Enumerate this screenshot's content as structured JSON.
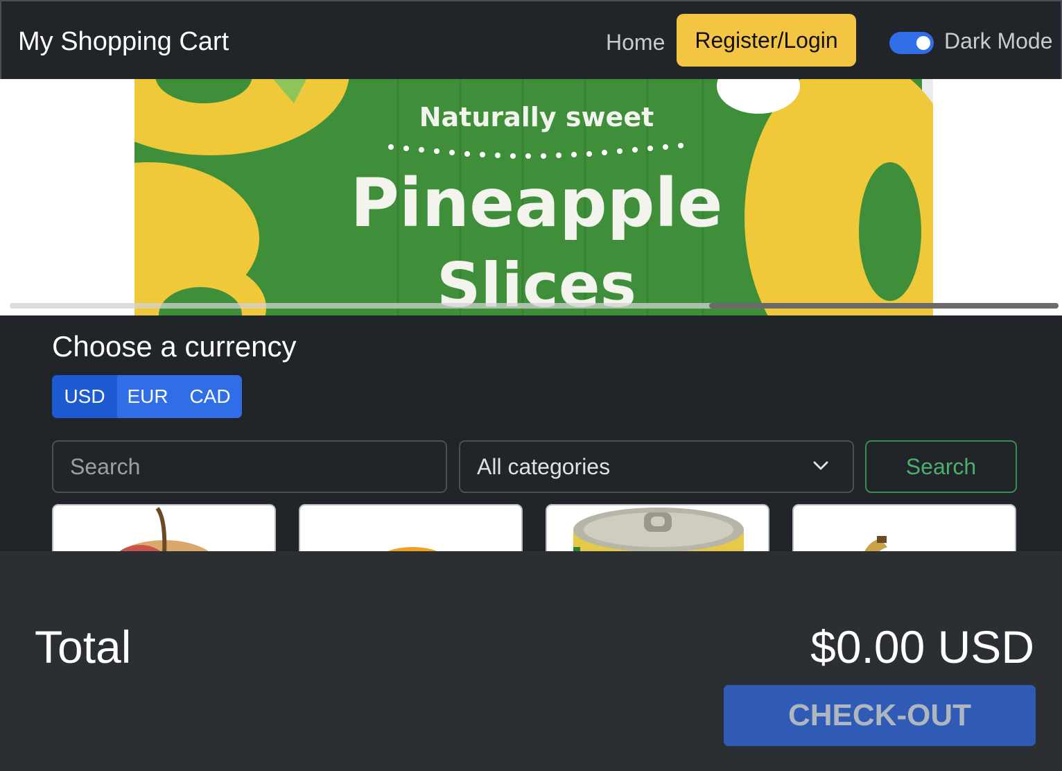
{
  "navbar": {
    "brand": "My Shopping Cart",
    "home_label": "Home",
    "login_label": "Register/Login",
    "dark_mode_label": "Dark Mode",
    "dark_mode_on": true
  },
  "hero": {
    "image_text_1": "Naturally sweet",
    "image_text_2": "Pineapple",
    "image_text_3": "Slices"
  },
  "currency": {
    "title": "Choose a currency",
    "options": [
      "USD",
      "EUR",
      "CAD"
    ],
    "selected": "USD"
  },
  "search": {
    "placeholder": "Search",
    "category_selected": "All categories",
    "button_label": "Search"
  },
  "products": [
    {
      "icon": "apple-icon"
    },
    {
      "icon": "orange-icon"
    },
    {
      "icon": "pineapple-can-icon"
    },
    {
      "icon": "banana-icon"
    }
  ],
  "cart": {
    "total_label": "Total",
    "total_value": "$0.00 USD",
    "checkout_label": "CHECK-OUT"
  },
  "colors": {
    "background": "#212529",
    "accent_blue": "#2f6ee6",
    "warning_yellow": "#f4c542",
    "success_green": "#3d8b57"
  }
}
